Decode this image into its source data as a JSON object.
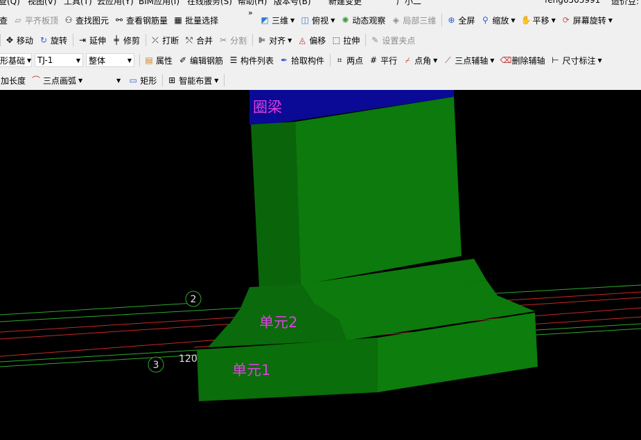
{
  "menu": {
    "items": [
      "查(Q)",
      "视图(V)",
      "工具(T)",
      "云应用(Y)",
      "BIM应用(I)",
      "在线服务(S)",
      "帮助(H)",
      "版本号(B)",
      "新建变更",
      "广小二"
    ],
    "user": "feng6503991",
    "right_text": "造价豆:"
  },
  "toolbar1": {
    "left": [
      "查",
      "平齐板顶",
      "查找图元",
      "查看钢筋量",
      "批量选择"
    ],
    "right": [
      "三维",
      "俯视",
      "动态观察",
      "局部三维",
      "全屏",
      "缩放",
      "平移",
      "屏幕旋转"
    ]
  },
  "toolbar2": {
    "items": [
      "移动",
      "旋转",
      "延伸",
      "修剪",
      "打断",
      "合并",
      "分割",
      "对齐",
      "偏移",
      "拉伸",
      "设置夹点"
    ]
  },
  "toolbar3": {
    "category": "形基础",
    "element": "TJ-1",
    "scope": "整体",
    "items": [
      "属性",
      "编辑钢筋",
      "构件列表",
      "拾取构件",
      "两点",
      "平行",
      "点角",
      "三点辅轴",
      "删除辅轴",
      "尺寸标注"
    ]
  },
  "toolbar4": {
    "items": [
      "加长度",
      "三点画弧",
      "",
      "矩形",
      "智能布置"
    ]
  },
  "viewport": {
    "labels": {
      "ring_beam": "圈梁",
      "unit2": "单元2",
      "unit1": "单元1",
      "axis2": "2",
      "axis3": "3",
      "dim": "120"
    }
  },
  "colors": {
    "toolbar_bg": "#f0f0f0",
    "viewport_bg": "#000000",
    "beam_blue": "#0a0a96",
    "column_green": "#0a6e0a",
    "label_magenta": "#e040e0",
    "axis_green": "#2fa82f",
    "axis_red": "#c82828"
  }
}
